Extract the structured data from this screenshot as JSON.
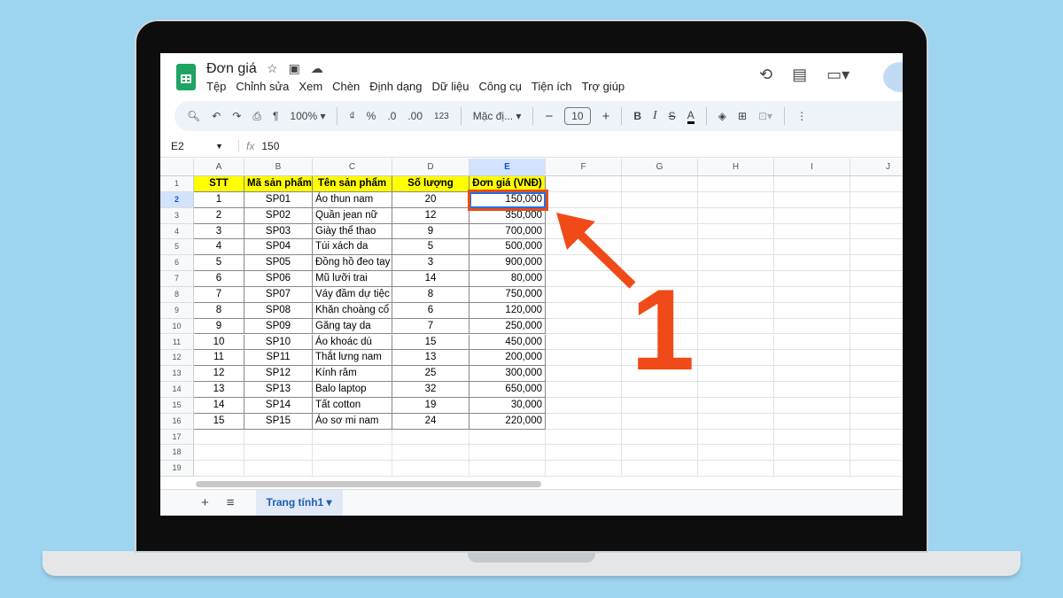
{
  "doc": {
    "title": "Đơn giá",
    "menu": [
      "Tệp",
      "Chỉnh sửa",
      "Xem",
      "Chèn",
      "Định dạng",
      "Dữ liệu",
      "Công cụ",
      "Tiện ích",
      "Trợ giúp"
    ]
  },
  "toolbar": {
    "zoom": "100%",
    "currency": "₫",
    "percent": "%",
    "dec_dec": ".0",
    "dec_inc": ".00",
    "format_number": "123",
    "font": "Mặc đị...",
    "font_size": "10",
    "minus": "−",
    "plus": "+",
    "bold": "B",
    "italic": "I",
    "strike": "S",
    "text_color": "A"
  },
  "formula": {
    "cell_ref": "E2",
    "fx": "fx",
    "value": "150"
  },
  "columns": [
    "A",
    "B",
    "C",
    "D",
    "E",
    "F",
    "G",
    "H",
    "I",
    "J"
  ],
  "rows": [
    "1",
    "2",
    "3",
    "4",
    "5",
    "6",
    "7",
    "8",
    "9",
    "10",
    "11",
    "12",
    "13",
    "14",
    "15",
    "16",
    "17",
    "18",
    "19"
  ],
  "table": {
    "headers": [
      "STT",
      "Mã sản phẩm",
      "Tên sản phẩm",
      "Số lượng",
      "Đơn giá (VNĐ)"
    ],
    "data": [
      [
        "1",
        "SP01",
        "Áo thun nam",
        "20",
        "150,000"
      ],
      [
        "2",
        "SP02",
        "Quần jean nữ",
        "12",
        "350,000"
      ],
      [
        "3",
        "SP03",
        "Giày thể thao",
        "9",
        "700,000"
      ],
      [
        "4",
        "SP04",
        "Túi xách da",
        "5",
        "500,000"
      ],
      [
        "5",
        "SP05",
        "Đồng hồ đeo tay",
        "3",
        "900,000"
      ],
      [
        "6",
        "SP06",
        "Mũ lưỡi trai",
        "14",
        "80,000"
      ],
      [
        "7",
        "SP07",
        "Váy đầm dự tiệc",
        "8",
        "750,000"
      ],
      [
        "8",
        "SP08",
        "Khăn choàng cổ",
        "6",
        "120,000"
      ],
      [
        "9",
        "SP09",
        "Găng tay da",
        "7",
        "250,000"
      ],
      [
        "10",
        "SP10",
        "Áo khoác dù",
        "15",
        "450,000"
      ],
      [
        "11",
        "SP11",
        "Thắt lưng nam",
        "13",
        "200,000"
      ],
      [
        "12",
        "SP12",
        "Kính râm",
        "25",
        "300,000"
      ],
      [
        "13",
        "SP13",
        "Balo laptop",
        "32",
        "650,000"
      ],
      [
        "14",
        "SP14",
        "Tất cotton",
        "19",
        "30,000"
      ],
      [
        "15",
        "SP15",
        "Áo sơ mi nam",
        "24",
        "220,000"
      ]
    ]
  },
  "sheet_tab": "Trang tính1",
  "annotation": {
    "step": "1",
    "color": "#f04a18"
  }
}
